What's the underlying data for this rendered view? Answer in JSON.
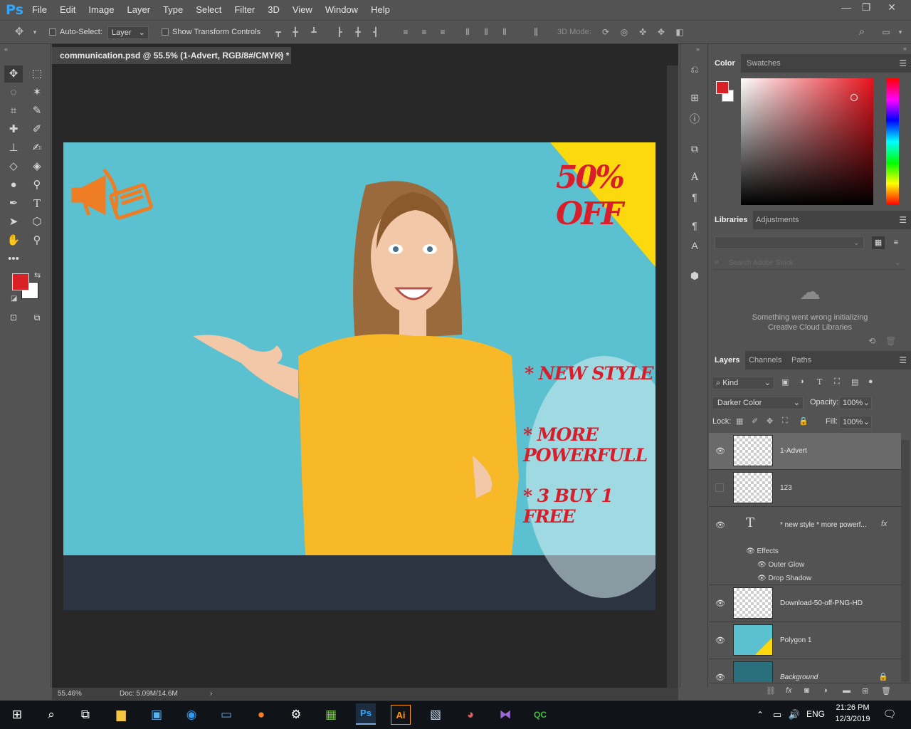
{
  "app": {
    "logo": "Ps",
    "accent": "#31a8ff"
  },
  "menu": [
    "File",
    "Edit",
    "Image",
    "Layer",
    "Type",
    "Select",
    "Filter",
    "3D",
    "View",
    "Window",
    "Help"
  ],
  "window_controls": {
    "minimize": "—",
    "restore": "❐",
    "close": "✕"
  },
  "options": {
    "auto_select_label": "Auto-Select:",
    "auto_select_checked": false,
    "auto_select_target": "Layer",
    "show_transform_label": "Show Transform Controls",
    "show_transform_checked": false,
    "mode_3d_label": "3D Mode:"
  },
  "document": {
    "tab_title": "communication.psd @ 55.5% (1-Advert, RGB/8#/CMYK) *",
    "zoom": "55.46%",
    "doc_size": "Doc: 5.09M/14.6M"
  },
  "ad": {
    "badge": "50% OFF",
    "lines": [
      "* NEW STYLE",
      "* MORE POWERFULL",
      "* 3 BUY 1 FREE"
    ],
    "bg_color": "#5bc0d0",
    "corner_color": "#fcd90f",
    "text_color": "#d81e2a",
    "bottom_bar_color": "#2b3440"
  },
  "color_panel": {
    "tabs": [
      "Color",
      "Swatches"
    ],
    "foreground": "#d92027",
    "background": "#ffffff"
  },
  "libraries_panel": {
    "tabs": [
      "Libraries",
      "Adjustments"
    ],
    "search_placeholder": "Search Adobe Stock",
    "error_line1": "Something went wrong initializing",
    "error_line2": "Creative Cloud Libraries"
  },
  "layers_panel": {
    "tabs": [
      "Layers",
      "Channels",
      "Paths"
    ],
    "filter_kind": "Kind",
    "blend_mode": "Darker Color",
    "opacity_label": "Opacity:",
    "opacity": "100%",
    "lock_label": "Lock:",
    "fill_label": "Fill:",
    "fill": "100%",
    "layers": [
      {
        "name": "1-Advert",
        "visible": true,
        "selected": true
      },
      {
        "name": "123",
        "visible": false,
        "selected": false
      },
      {
        "name": "* new style  * more powerf...",
        "visible": true,
        "selected": false,
        "type": "text",
        "effects_label": "Effects",
        "effects": [
          "Outer Glow",
          "Drop Shadow"
        ]
      },
      {
        "name": "Download-50-off-PNG-HD",
        "visible": true,
        "selected": false
      },
      {
        "name": "Polygon 1",
        "visible": true,
        "selected": false
      },
      {
        "name": "Background",
        "visible": true,
        "selected": false,
        "locked": true
      }
    ]
  },
  "taskbar": {
    "language": "ENG",
    "time": "21:26 PM",
    "date": "12/3/2019"
  }
}
